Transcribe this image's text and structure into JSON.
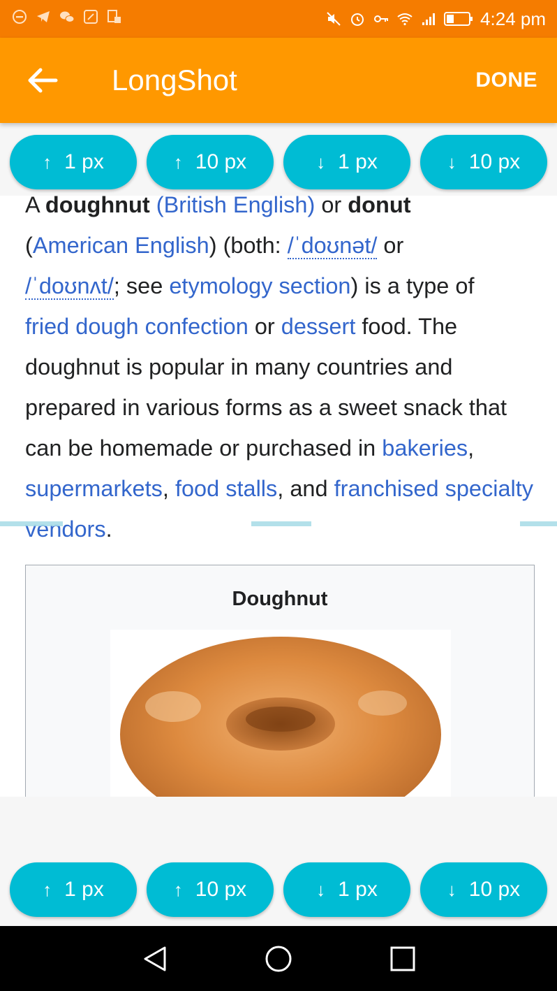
{
  "statusbar": {
    "time": "4:24 pm",
    "left_icons": [
      "dnd-icon",
      "telegram-icon",
      "wechat-icon",
      "edit-icon",
      "sim-icon"
    ],
    "right_icons": [
      "mute-icon",
      "alarm-icon",
      "vpn-key-icon",
      "wifi-icon",
      "signal-icon",
      "battery-icon"
    ]
  },
  "appbar": {
    "title": "LongShot",
    "done_label": "DONE",
    "back_icon": "arrow-back-icon",
    "background": "#ff9800"
  },
  "step_buttons": [
    {
      "arrow": "↑",
      "label": "1 px"
    },
    {
      "arrow": "↑",
      "label": "10 px"
    },
    {
      "arrow": "↓",
      "label": "1 px"
    },
    {
      "arrow": "↓",
      "label": "10 px"
    }
  ],
  "article": {
    "cut_line": {
      "p1": "A ",
      "b1": "doughnut",
      "p2": " ",
      "l1": "(British English)",
      "p3": " or ",
      "b2": "donut"
    },
    "p_open": "(",
    "am_english": "American English",
    "both": ") (both: ",
    "ipa1": "/ˈdoʊnət/",
    "or": " or ",
    "ipa2": "/ˈdoʊnʌt/",
    "see": "; see ",
    "etymology": "etymology section",
    "type_of": ") is a type of ",
    "fried_dough": "fried dough confection",
    "or2": " or ",
    "dessert": "dessert",
    "rest": " food. The doughnut is popular in many countries and prepared in various forms as a sweet snack that can be homemade or purchased in ",
    "bakeries": "bakeries",
    "comma1": ", ",
    "supermarkets": "supermarkets",
    "comma2": ", ",
    "food_stalls": "food stalls",
    "and": ", and ",
    "franchised": "franchised specialty vendors",
    "period": "."
  },
  "infobox": {
    "title": "Doughnut",
    "image": "doughnut-photo"
  },
  "navbar": [
    "back-nav-icon",
    "home-nav-icon",
    "recents-nav-icon"
  ],
  "colors": {
    "statusbar": "#f57c00",
    "accent": "#00bcd4",
    "link": "#3366cc"
  }
}
